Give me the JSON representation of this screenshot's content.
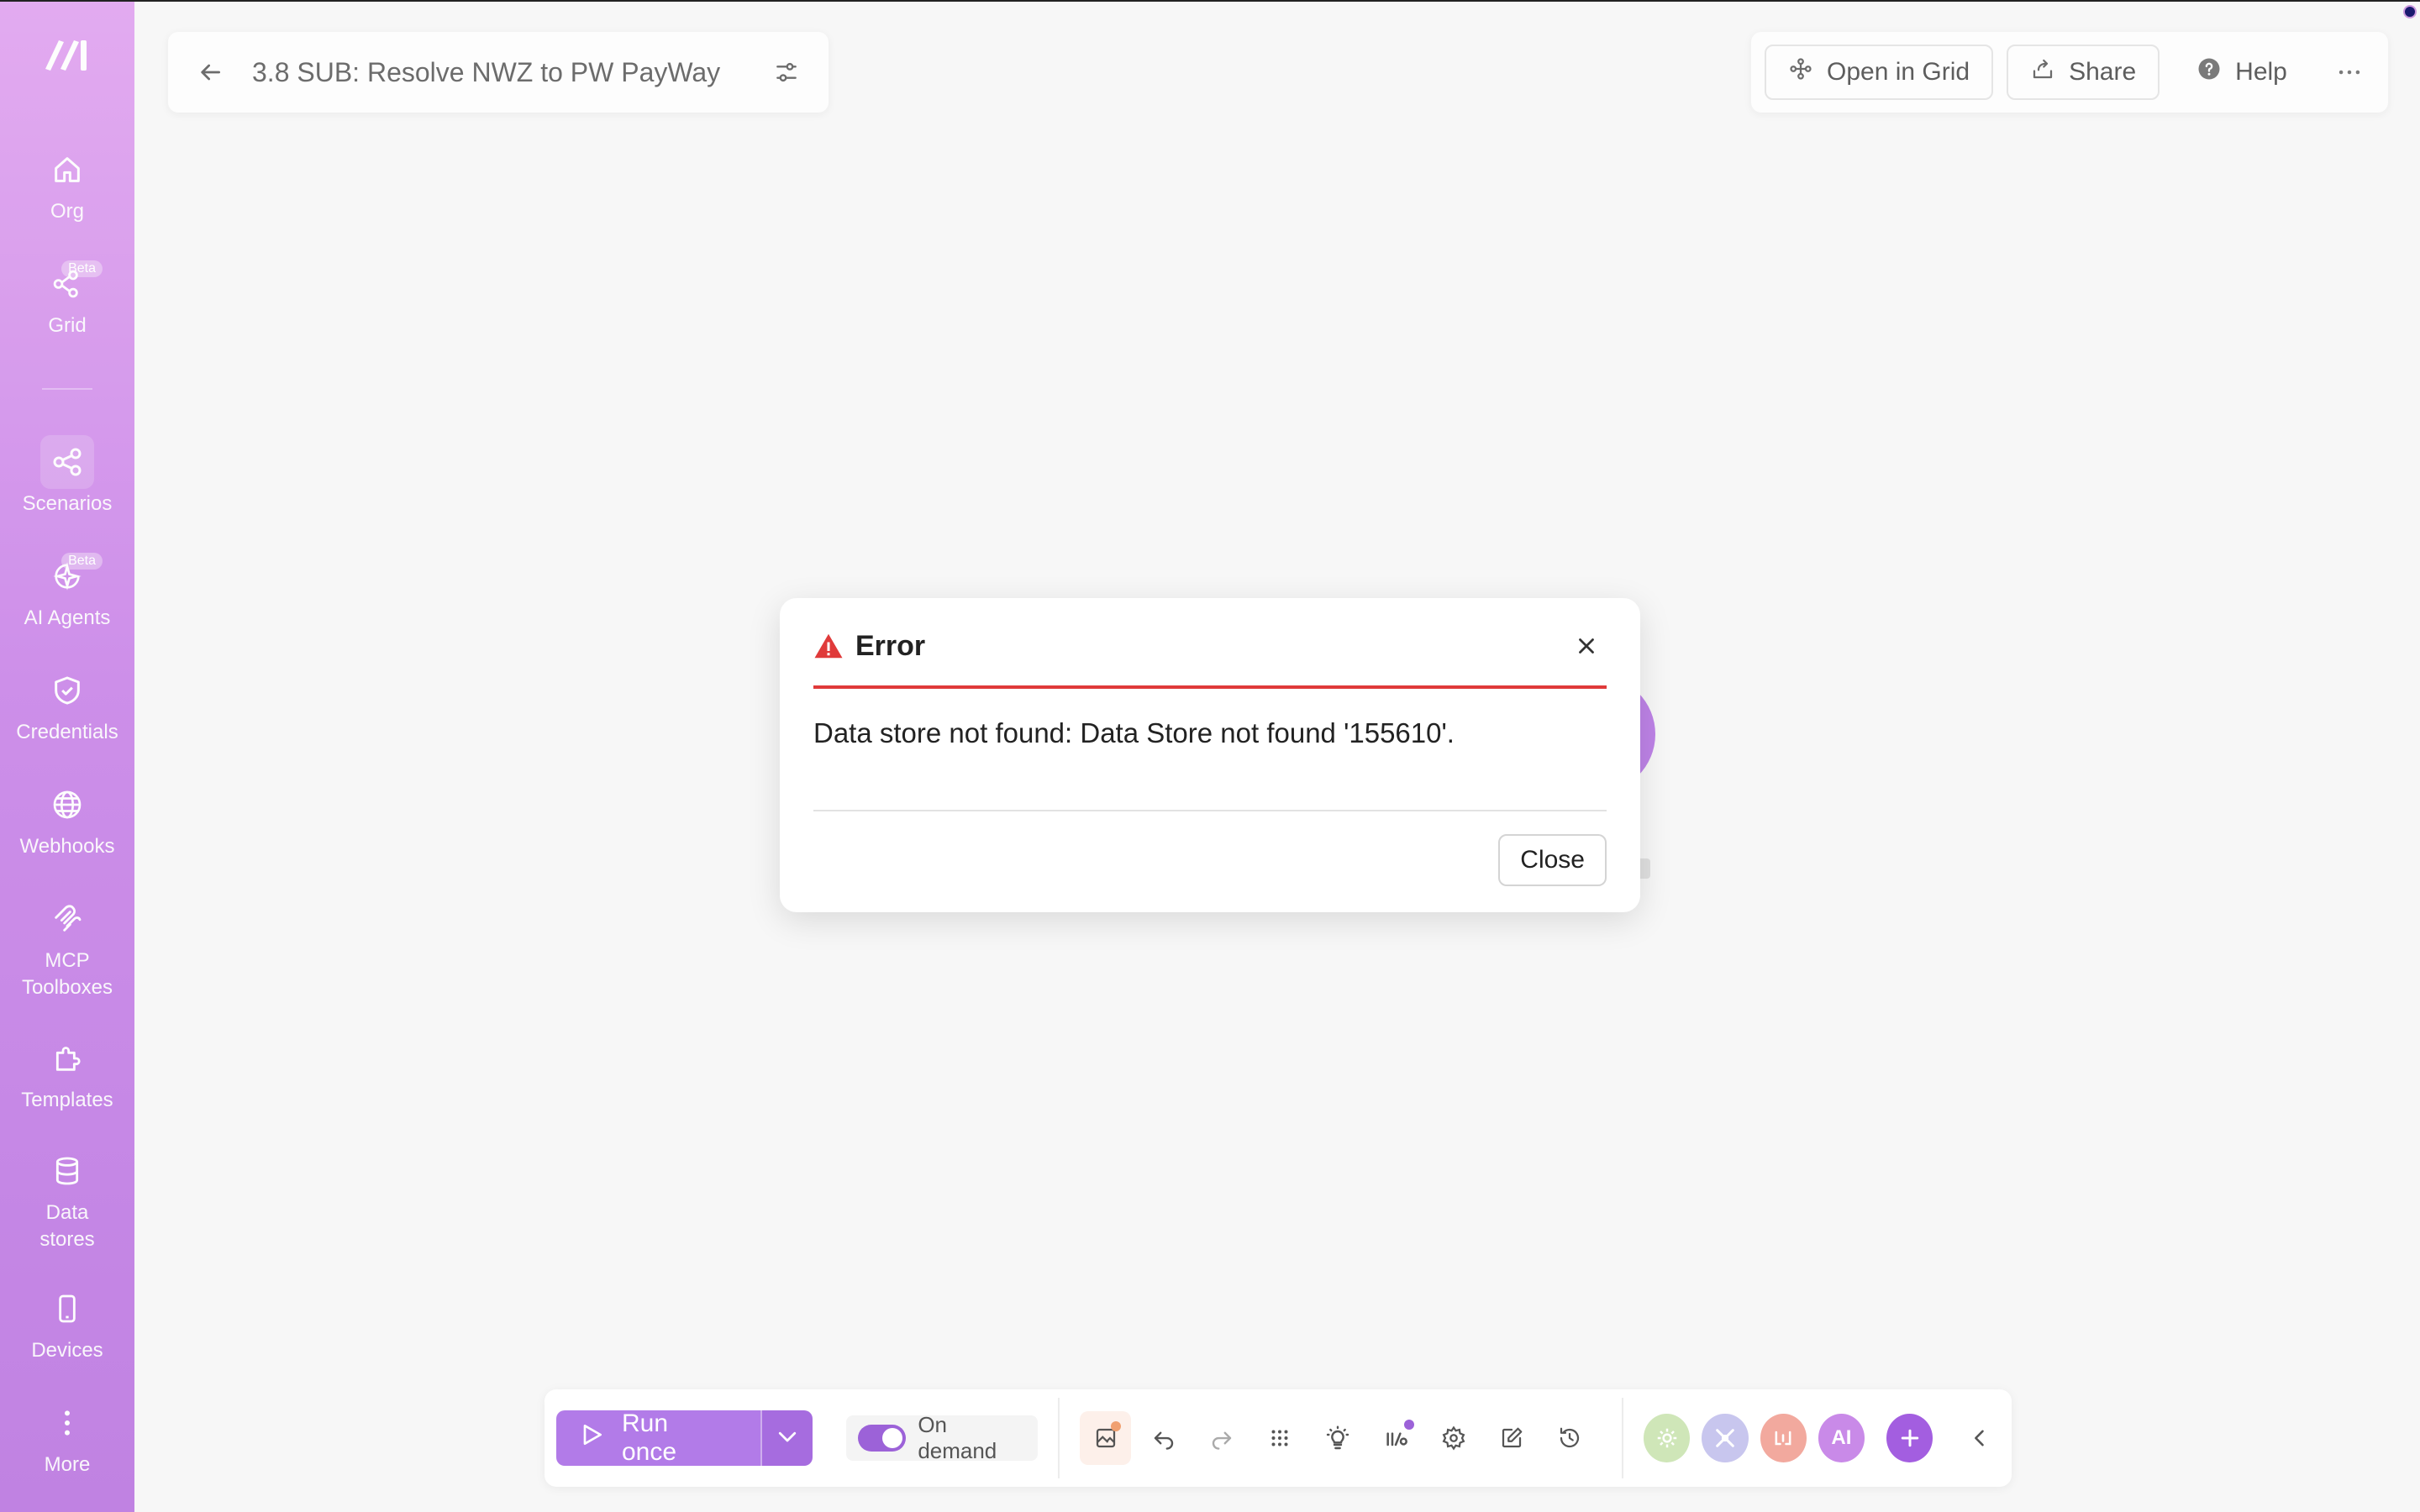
{
  "scenario": {
    "title": "3.8 SUB: Resolve NWZ to PW PayWay"
  },
  "sidebar": {
    "items": [
      {
        "label": "Org",
        "icon": "home-icon"
      },
      {
        "label": "Grid",
        "icon": "grid-nodes-icon",
        "badge": "Beta"
      },
      {
        "label": "Scenarios",
        "icon": "share-nodes-icon",
        "active": true
      },
      {
        "label": "AI Agents",
        "icon": "ai-sparkle-icon",
        "badge": "Beta"
      },
      {
        "label": "Credentials",
        "icon": "shield-check-icon"
      },
      {
        "label": "Webhooks",
        "icon": "globe-icon"
      },
      {
        "label": "MCP Toolboxes",
        "icon": "mcp-icon"
      },
      {
        "label": "Templates",
        "icon": "puzzle-icon"
      },
      {
        "label": "Data stores",
        "icon": "database-icon"
      },
      {
        "label": "Devices",
        "icon": "mobile-device-icon"
      },
      {
        "label": "More",
        "icon": "vertical-dots-icon"
      }
    ]
  },
  "header": {
    "open_in_grid": "Open in Grid",
    "share": "Share",
    "help": "Help"
  },
  "dialog": {
    "title": "Error",
    "message": "Data store not found: Data Store not found '155610'.",
    "close_label": "Close"
  },
  "bottom_bar": {
    "run_label": "Run once",
    "schedule_label": "On demand",
    "app_badges": [
      "AI"
    ]
  },
  "colors": {
    "accent": "#b27be8",
    "error": "#e03a3a",
    "sidebar_top": "#e09ff0",
    "sidebar_bottom": "#b86fe0"
  }
}
